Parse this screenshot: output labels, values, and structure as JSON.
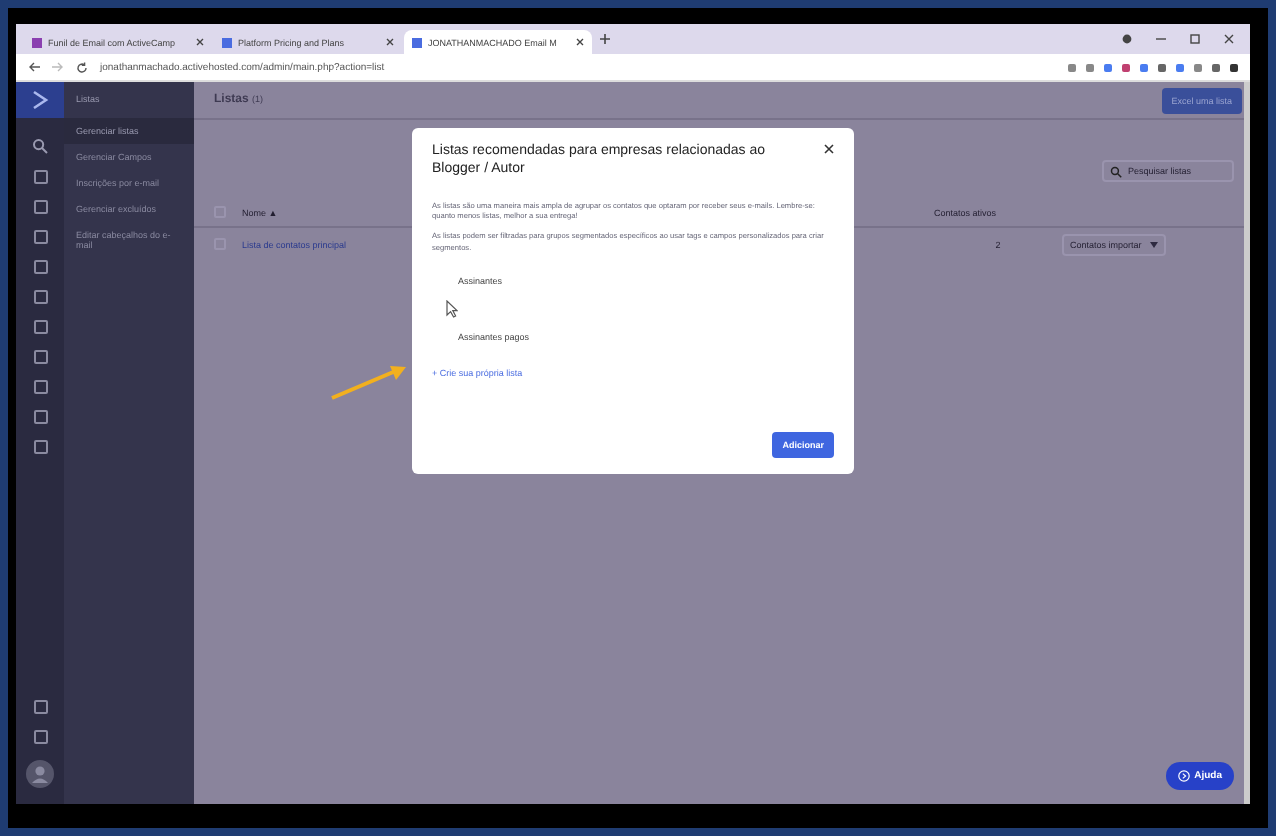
{
  "browser": {
    "tabs": [
      {
        "title": "Funil de Email com ActiveCamp",
        "selected": false
      },
      {
        "title": "Platform Pricing and Plans",
        "selected": false
      },
      {
        "title": "JONATHANMACHADO Email M",
        "selected": true
      }
    ],
    "address": "jonathanmachado.activehosted.com/admin/main.php?action=list"
  },
  "sidebar": {
    "title": "Listas",
    "items": [
      {
        "label": "Gerenciar listas",
        "selected": true
      },
      {
        "label": "Gerenciar Campos",
        "selected": false
      },
      {
        "label": "Inscrições por e-mail",
        "selected": false
      },
      {
        "label": "Gerenciar excluídos",
        "selected": false
      },
      {
        "label": "Editar cabeçalhos do e-mail",
        "selected": false
      }
    ]
  },
  "page": {
    "title": "Listas",
    "count": "(1)",
    "add_button": "Excel uma lista",
    "search": {
      "placeholder": "Pesquisar listas"
    },
    "header_checked": false,
    "columns": [
      "Nome ▲",
      "Contatos ativos"
    ],
    "rows": [
      {
        "checked": false,
        "name": "Lista de contatos principal",
        "active": "2",
        "action": "Contatos importar"
      }
    ]
  },
  "modal": {
    "title": "Listas recomendadas para empresas relacionadas ao Blogger / Autor",
    "paragraphs": [
      "As listas são uma maneira mais ampla de agrupar os contatos que optaram por receber seus e-mails. Lembre-se: quanto menos listas, melhor a sua entrega!",
      "As listas podem ser filtradas para grupos segmentados específicos ao usar tags e campos personalizados para criar segmentos."
    ],
    "options": [
      "Assinantes",
      "Assinantes pagos"
    ],
    "create_link": "+ Crie sua própria lista",
    "button": "Adicionar"
  },
  "help_button": "Ajuda"
}
